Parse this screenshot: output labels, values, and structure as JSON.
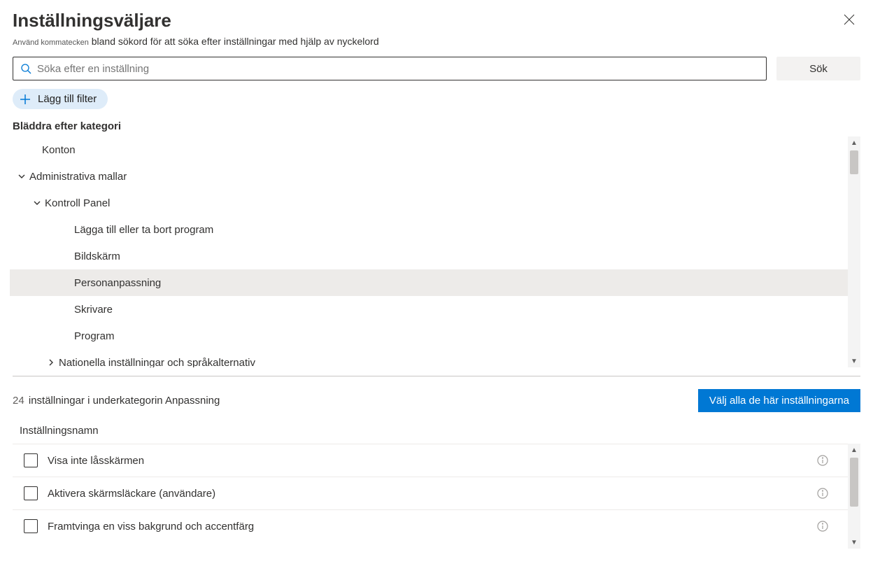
{
  "header": {
    "title": "Inställningsväljare",
    "subtitle_prefix": "Använd kommatecken",
    "subtitle_rest": " bland sökord för att söka efter inställningar med hjälp av nyckelord"
  },
  "search": {
    "placeholder": "Söka efter en inställning",
    "button": "Sök"
  },
  "filter": {
    "add_label": "Lägg till filter"
  },
  "browse": {
    "heading": "Bläddra efter kategori"
  },
  "tree": {
    "items": [
      {
        "label": "Konton",
        "level": "indent-0",
        "caret": "none"
      },
      {
        "label": "Administrativa mallar",
        "level": "lvl1",
        "caret": "open"
      },
      {
        "label": "Kontroll   Panel",
        "level": "lvl2",
        "caret": "open"
      },
      {
        "label": "Lägga till eller ta bort program",
        "level": "lvl3-nocaret",
        "caret": "none"
      },
      {
        "label": "Bildskärm",
        "level": "lvl3-nocaret",
        "caret": "none"
      },
      {
        "label": "Personanpassning",
        "level": "lvl3-nocaret",
        "caret": "none",
        "selected": true
      },
      {
        "label": "Skrivare",
        "level": "lvl3-nocaret",
        "caret": "none"
      },
      {
        "label": "Program",
        "level": "lvl3-nocaret",
        "caret": "none"
      },
      {
        "label": "Nationella inställningar och språkalternativ",
        "level": "lvl3",
        "caret": "closed"
      }
    ]
  },
  "count": {
    "number": "24",
    "text": " inställningar i underkategorin Anpassning",
    "select_all": "Välj alla de här inställningarna"
  },
  "table": {
    "col_header": "Inställningsnamn",
    "rows": [
      {
        "label": "Visa inte låsskärmen"
      },
      {
        "label": "Aktivera skärmsläckare (användare)"
      },
      {
        "label": "Framtvinga en viss bakgrund och accentfärg"
      }
    ]
  }
}
